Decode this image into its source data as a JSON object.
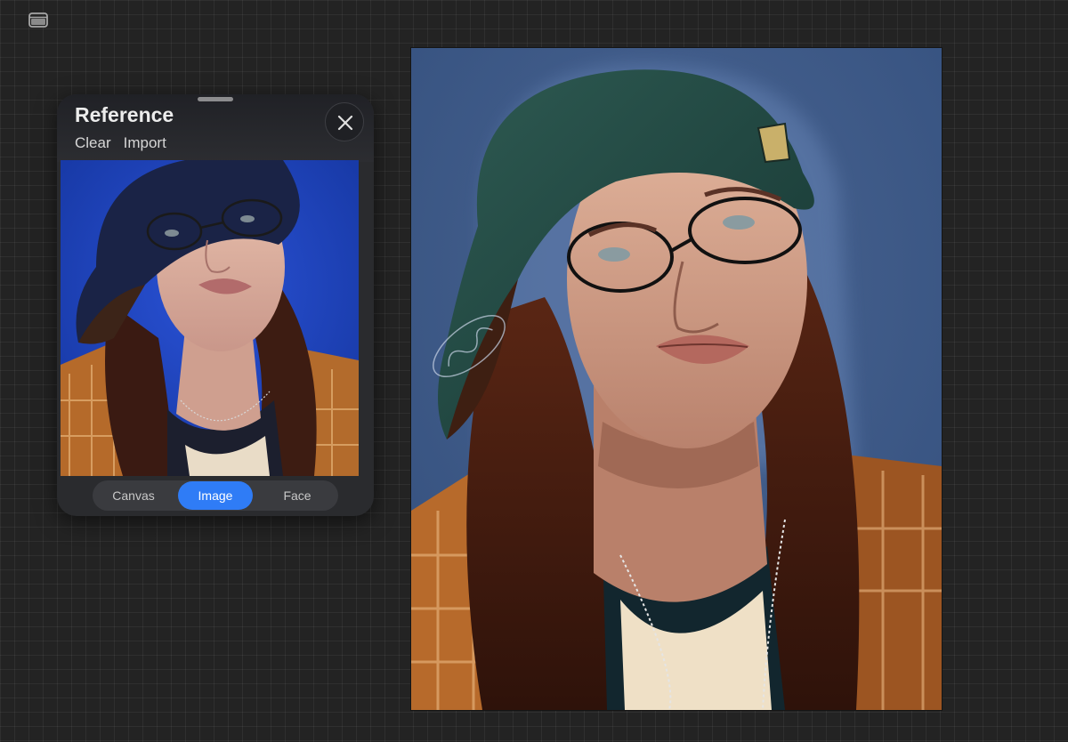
{
  "toolbar": {
    "sidebar_icon": "sidebar-icon"
  },
  "reference_panel": {
    "title": "Reference",
    "actions": [
      {
        "label": "Clear"
      },
      {
        "label": "Import"
      }
    ],
    "close_icon": "close-icon",
    "modes": [
      {
        "label": "Canvas",
        "active": false
      },
      {
        "label": "Image",
        "active": true
      },
      {
        "label": "Face",
        "active": false
      }
    ],
    "image": {
      "description_icon": "photo-portrait",
      "background_color": "#1a3fb8"
    }
  },
  "canvas": {
    "artwork": "digital-painting-portrait",
    "background_color": "#3f5a85"
  },
  "colors": {
    "accent": "#2f7cf6",
    "workspace": "#232323",
    "panel": "#2a2b2e"
  }
}
